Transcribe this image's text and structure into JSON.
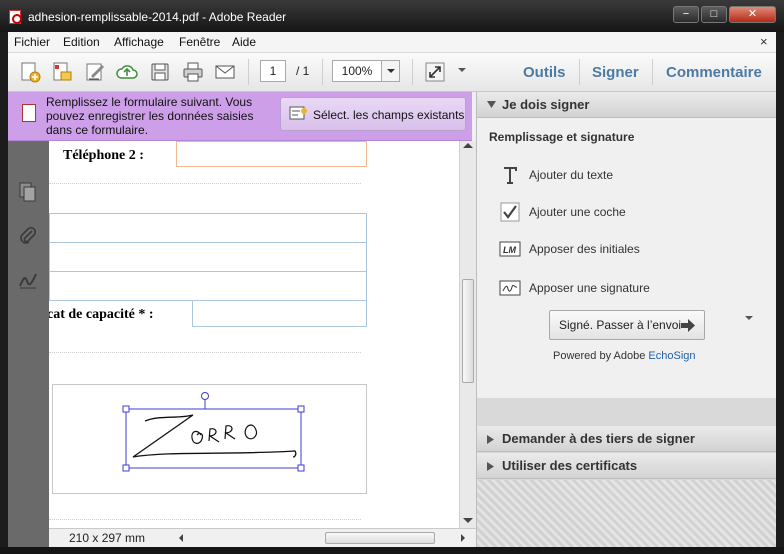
{
  "window": {
    "title": "adhesion-remplissable-2014.pdf - Adobe Reader",
    "minimize_glyph": "−",
    "maximize_glyph": "□",
    "close_glyph": "✕",
    "icon": "pdf-file-icon"
  },
  "menu": {
    "items": [
      "Fichier",
      "Edition",
      "Affichage",
      "Fenêtre",
      "Aide"
    ],
    "close_glyph": "×"
  },
  "toolbar": {
    "icons": [
      "create-icon",
      "open-icon",
      "sign-icon",
      "cloud-upload-icon",
      "save-icon",
      "print-icon",
      "email-icon",
      "fullscreen-icon",
      "more-chevron-icon"
    ],
    "page_current": "1",
    "page_total": "/ 1",
    "zoom": "100%",
    "tabs": [
      "Outils",
      "Signer",
      "Commentaire"
    ]
  },
  "form_bar": {
    "message": "Remplissez le formulaire suivant. Vous pouvez enregistrer les données saisies dans ce formulaire.",
    "button_label": "Sélect. les champs existants"
  },
  "left_nav": {
    "icons": [
      "pages-icon",
      "attachments-icon",
      "signatures-icon"
    ]
  },
  "document": {
    "telephone_label": "Téléphone 2 :",
    "capacity_label": "cat de capacité * :",
    "signature_text": "ZORRO",
    "page_size": "210 x 297 mm"
  },
  "right_panel": {
    "sections": {
      "sign": "Je dois signer",
      "request": "Demander à des tiers de signer",
      "certs": "Utiliser des certificats"
    },
    "heading": "Remplissage et signature",
    "items": [
      {
        "icon": "text-t-icon",
        "label": "Ajouter du texte"
      },
      {
        "icon": "checkmark-icon",
        "label": "Ajouter une coche"
      },
      {
        "icon": "initials-icon",
        "label": "Apposer des initiales"
      },
      {
        "icon": "signature-icon",
        "label": "Apposer une signature"
      }
    ],
    "send_button": "Signé. Passer à l’envoi",
    "powered_by": "Powered by Adobe ",
    "echosign": "EchoSign"
  },
  "colors": {
    "form_bar": "#cd9fe8",
    "tab_text": "#4d7aa3",
    "field_border": "#a9c8e0",
    "left_nav": "#6a6a6a"
  }
}
